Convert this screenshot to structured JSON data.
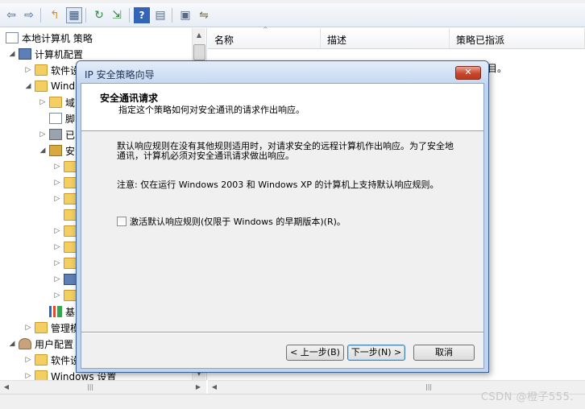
{
  "toolbar": {
    "buttons": [
      {
        "icon": "back-arrow-icon",
        "glyph": "⇦"
      },
      {
        "icon": "forward-arrow-icon",
        "glyph": "⇨"
      },
      {
        "icon": "up-folder-icon",
        "glyph": "↰"
      },
      {
        "icon": "show-hide-tree-icon",
        "glyph": "▦"
      },
      {
        "icon": "refresh-icon",
        "glyph": "↻"
      },
      {
        "icon": "export-list-icon",
        "glyph": "⇲"
      },
      {
        "icon": "help-icon",
        "glyph": "?"
      },
      {
        "icon": "properties-icon",
        "glyph": "▤"
      },
      {
        "icon": "manage-filters-icon",
        "glyph": "▣"
      },
      {
        "icon": "assign-icon",
        "glyph": "⇋"
      }
    ]
  },
  "tree": {
    "items": [
      {
        "label": "本地计算机 策略",
        "icon": "doc"
      },
      {
        "label": "计算机配置",
        "icon": "computer"
      },
      {
        "label": "软件设",
        "icon": "folder"
      },
      {
        "label": "Wind",
        "icon": "folder"
      },
      {
        "label": "域",
        "icon": "folder"
      },
      {
        "label": "脚",
        "icon": "doc"
      },
      {
        "label": "已",
        "icon": "printer"
      },
      {
        "label": "安",
        "icon": "lock"
      },
      {
        "label": "",
        "icon": "folder"
      },
      {
        "label": "",
        "icon": "folder"
      },
      {
        "label": "",
        "icon": "folder"
      },
      {
        "label": "",
        "icon": "folder"
      },
      {
        "label": "",
        "icon": "folder"
      },
      {
        "label": "",
        "icon": "folder"
      },
      {
        "label": "",
        "icon": "folder"
      },
      {
        "label": "",
        "icon": "computer"
      },
      {
        "label": "",
        "icon": "folder"
      },
      {
        "label": "基",
        "icon": "chart"
      },
      {
        "label": "管理模",
        "icon": "folder"
      },
      {
        "label": "用户配置",
        "icon": "user"
      },
      {
        "label": "软件设",
        "icon": "folder"
      },
      {
        "label": "Windows 设置",
        "icon": "folder"
      }
    ]
  },
  "list": {
    "columns": [
      "名称",
      "描述",
      "策略已指派"
    ],
    "message": "目。"
  },
  "dialog": {
    "title": "IP 安全策略向导",
    "close_label": "✕",
    "header_title": "安全通讯请求",
    "header_subtitle": "指定这个策略如何对安全通讯的请求作出响应。",
    "paragraph1": "默认响应规则在没有其他规则适用时，对请求安全的远程计算机作出响应。为了安全地通讯，计算机必须对安全通讯请求做出响应。",
    "paragraph2": "注意: 仅在运行 Windows 2003 和 Windows XP 的计算机上支持默认响应规则。",
    "checkbox_label": "激活默认响应规则(仅限于 Windows 的早期版本)(R)。",
    "checkbox_checked": false,
    "back_button": "< 上一步(B)",
    "next_button": "下一步(N) >",
    "cancel_button": "取消"
  },
  "watermark": "CSDN @橙子555."
}
